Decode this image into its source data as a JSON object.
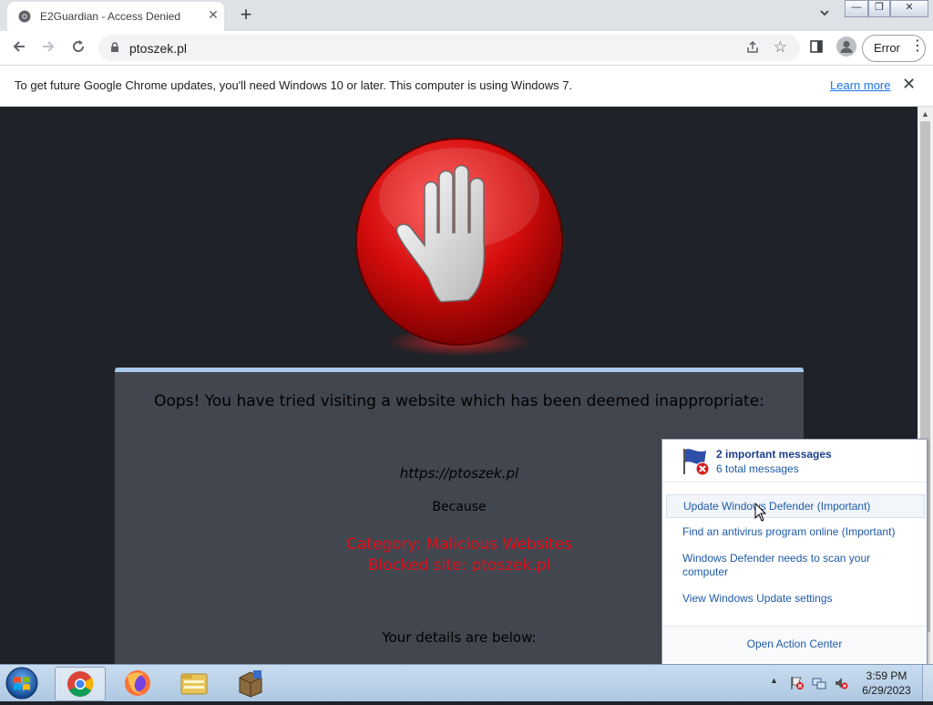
{
  "browser": {
    "tab_title": "E2Guardian - Access Denied",
    "url": "ptoszek.pl",
    "error_label": "Error",
    "menu_glyph": "⋮",
    "new_tab_glyph": "+",
    "tab_close_glyph": "✕"
  },
  "window_controls": {
    "minimize": "—",
    "restore": "❐",
    "close": "✕"
  },
  "infobar": {
    "message": "To get future Google Chrome updates, you'll need Windows 10 or later. This computer is using Windows 7.",
    "learn_more": "Learn more",
    "close_glyph": "✕"
  },
  "page": {
    "headline": "Oops! You have tried visiting a website which has been deemed inappropriate:",
    "blocked_url": "https://ptoszek.pl",
    "because": "Because",
    "category_line": "Category: Malicious Websites",
    "blocked_site_line": "Blocked site: ptoszek.pl",
    "details_heading": "Your details are below:"
  },
  "action_center_popup": {
    "important_messages": "2 important messages",
    "total_messages": "6 total messages",
    "items": [
      "Update Windows Defender (Important)",
      "Find an antivirus program online (Important)",
      "Windows Defender needs to scan your computer",
      "View Windows Update settings"
    ],
    "open_action_center": "Open Action Center"
  },
  "taskbar": {
    "time": "3:59 PM",
    "date": "6/29/2023",
    "tray_expand_glyph": "▲"
  },
  "colors": {
    "page_background": "#1f2228",
    "panel_background": "#42464f",
    "panel_top_border": "#a8c8e8",
    "category_red": "#e0101a",
    "link_blue": "#1e5aa8"
  },
  "icons": [
    "chrome-favicon",
    "lock-icon",
    "share-icon",
    "star-icon",
    "side-panel-icon",
    "profile-icon",
    "stop-hand-icon",
    "action-center-flag-icon",
    "windows-start-icon",
    "chrome-icon",
    "firefox-icon",
    "file-explorer-icon",
    "archive-app-icon",
    "action-center-tray-icon",
    "network-tray-icon",
    "volume-muted-tray-icon"
  ]
}
